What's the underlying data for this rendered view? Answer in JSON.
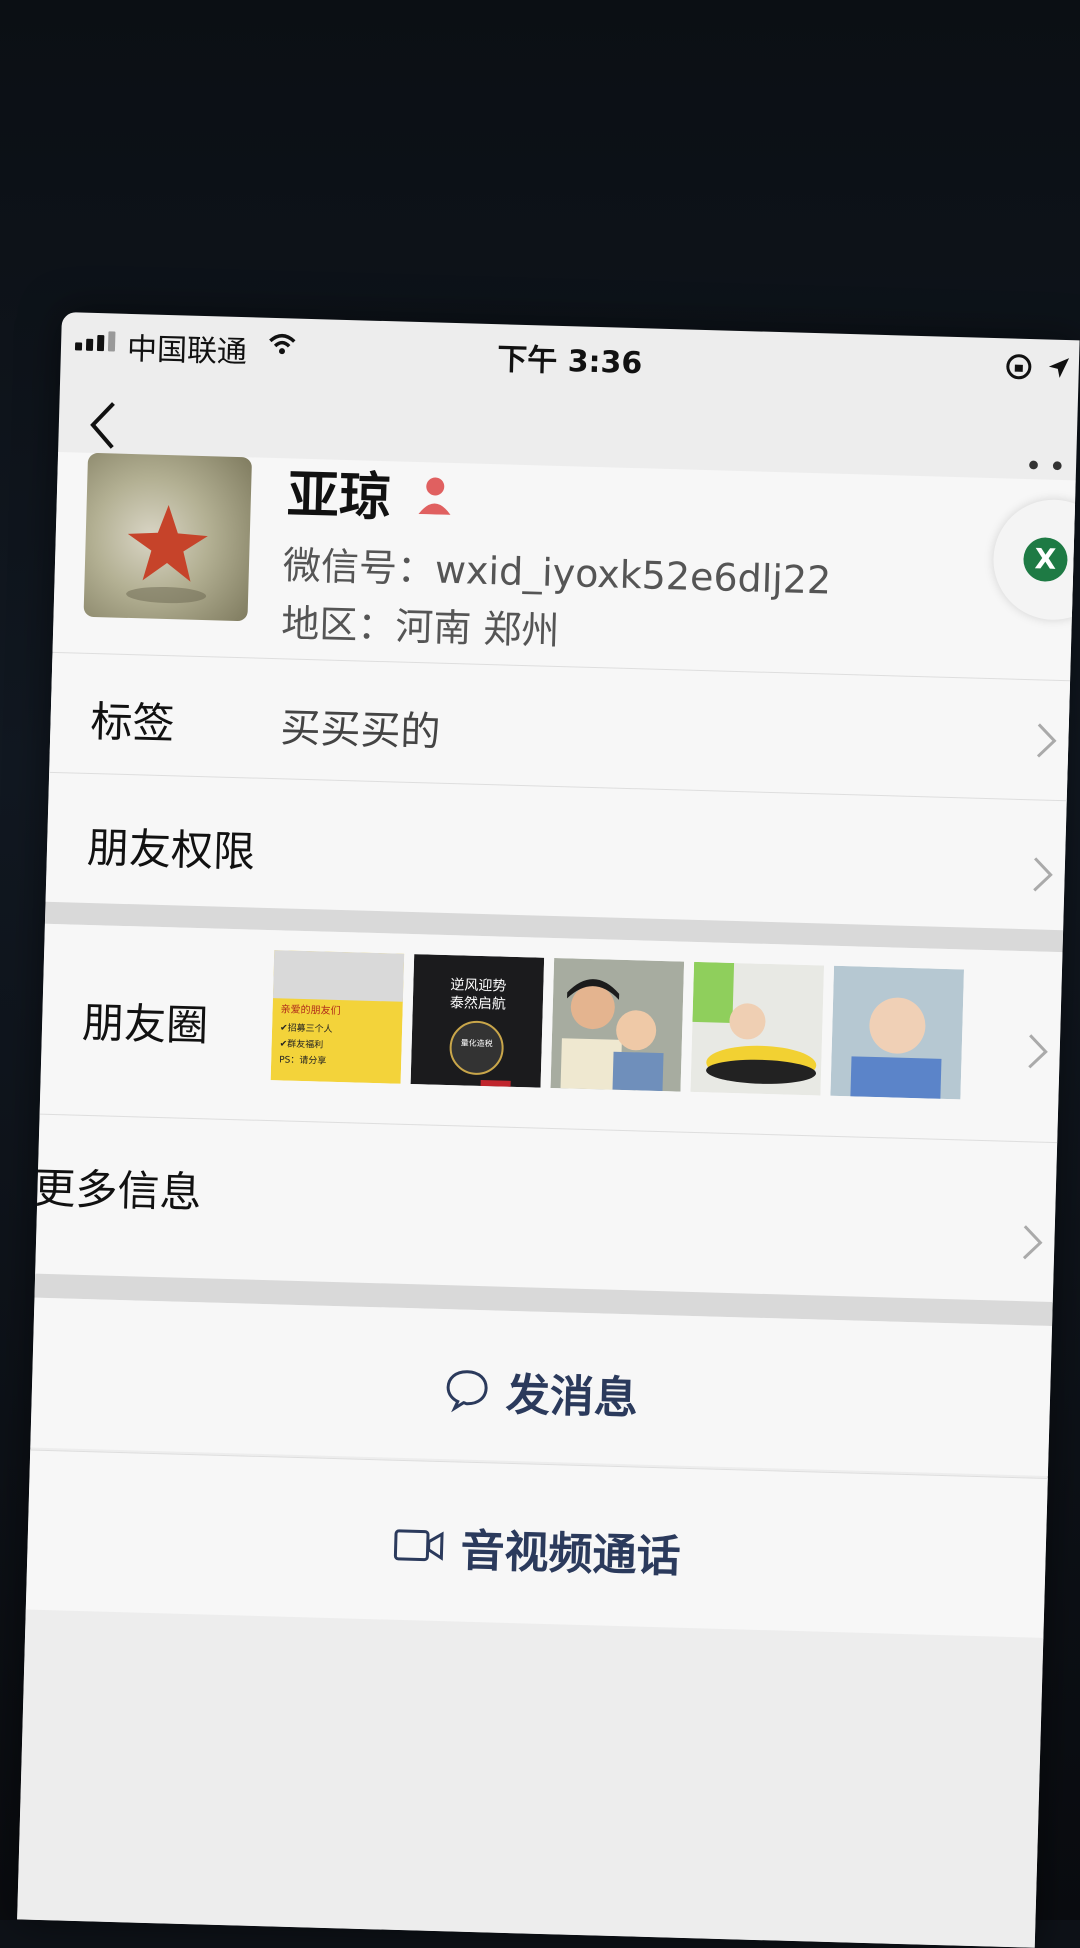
{
  "status_bar": {
    "carrier": "中国联通",
    "time": "下午 3:36"
  },
  "profile": {
    "name": "亚琼",
    "wechat_id": "微信号：wxid_iyoxk52e6dlj22",
    "region": "地区：河南 郑州",
    "gender_icon": "female-icon"
  },
  "rows": {
    "tag_label": "标签",
    "tag_value": "买买买的",
    "friend_perm_label": "朋友权限",
    "moments_label": "朋友圈",
    "more_info_label": "更多信息"
  },
  "moments_thumbs": {
    "t1_lines": [
      "亲爱的朋友们",
      "✔招募三个人",
      "✔群友福利",
      "PS：请分享"
    ],
    "t2_lines": [
      "逆风迎势",
      "泰然启航",
      "量化造税"
    ],
    "t3_desc": "mother-and-baby",
    "t4_desc": "baby-on-toy",
    "t5_desc": "baby-smiling"
  },
  "actions": {
    "send_message": "发消息",
    "video_call": "音视频通话"
  },
  "floating": {
    "x_label": "X"
  },
  "colors": {
    "page_bg": "#ededed",
    "cell_bg": "#f7f7f7",
    "action_text": "#2b3a5c",
    "gender_icon": "#e06060",
    "float_dot": "#1e7a44"
  }
}
